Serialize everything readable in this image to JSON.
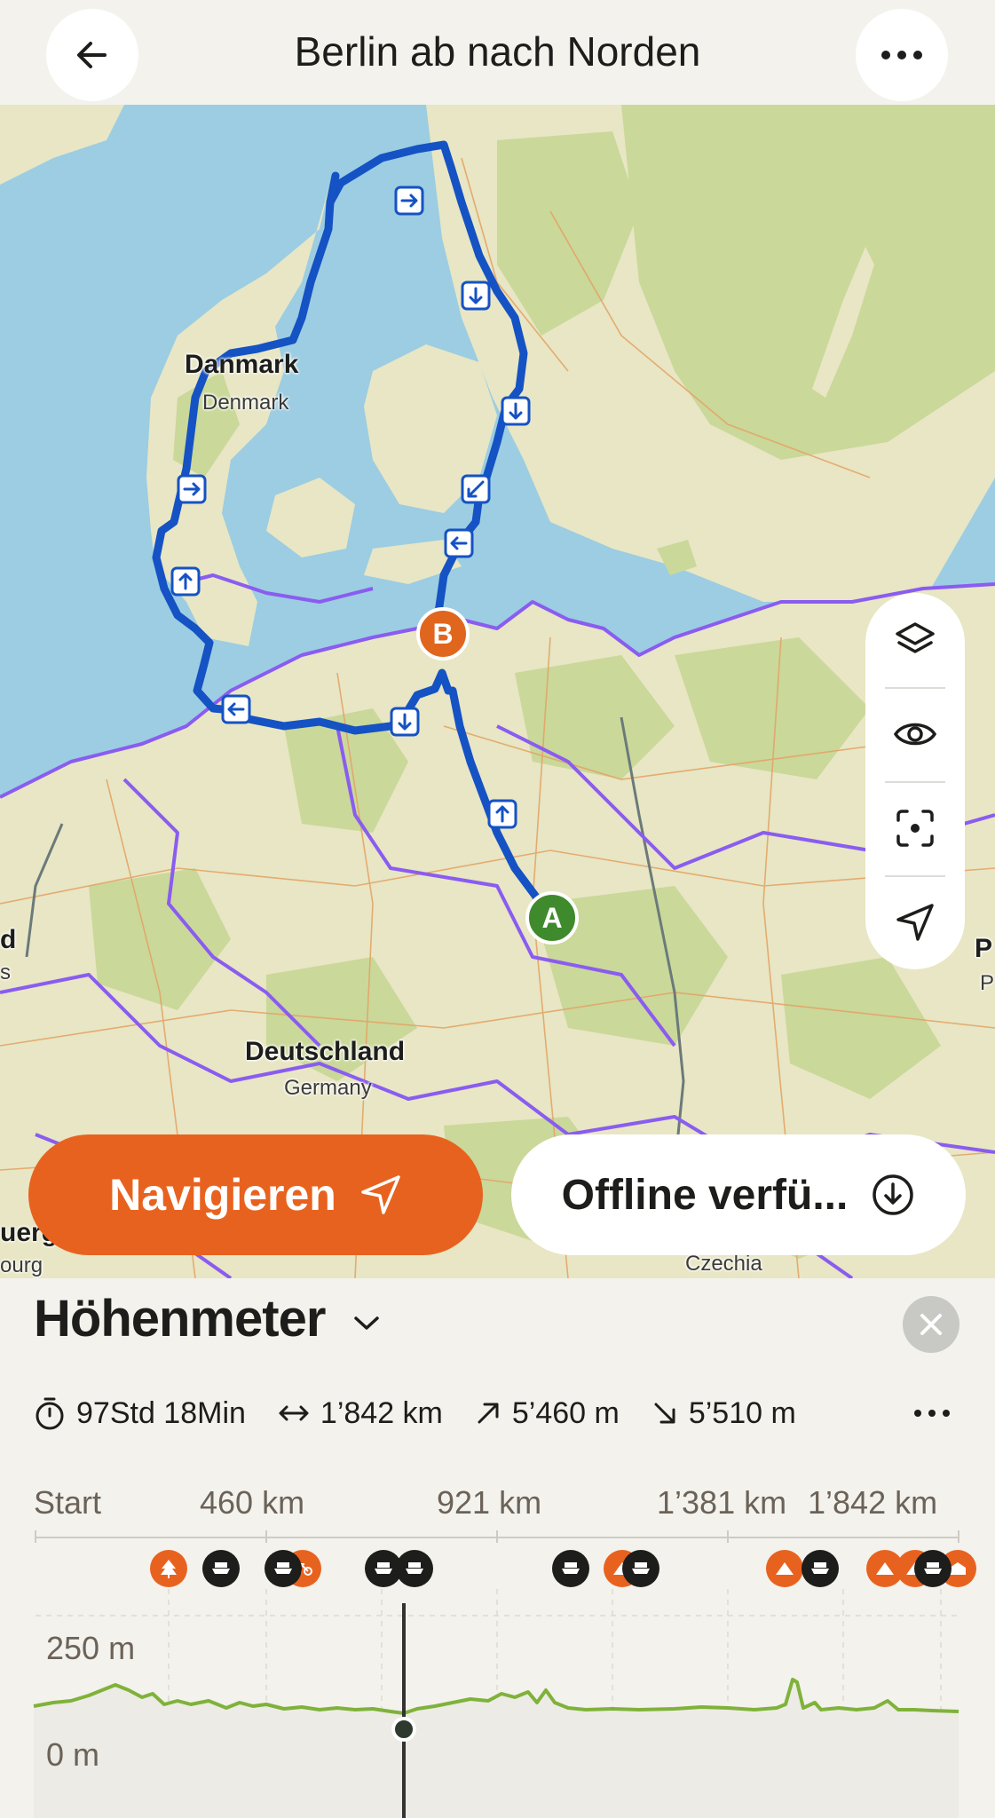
{
  "header": {
    "title": "Berlin ab nach Norden",
    "back_icon": "arrow-left-icon",
    "more_icon": "more-horizontal-icon"
  },
  "map": {
    "labels": {
      "denmark_local": "Danmark",
      "denmark_en": "Denmark",
      "germany_local": "Deutschland",
      "germany_en": "Germany",
      "czechia": "Czechia",
      "edge_left_1": "d",
      "edge_left_2": "s",
      "edge_left_3": "uerg",
      "edge_left_4": "ourg",
      "edge_right_1": "P",
      "edge_right_2": "P"
    },
    "start_marker": "A",
    "end_marker": "B",
    "colors": {
      "water": "#9ccde2",
      "land": "#e8e6c4",
      "forest": "#cad89a",
      "route": "#1552c4",
      "border": "#8a5cf0",
      "start": "#3f8a2c",
      "end": "#e0661d"
    },
    "toolbar": [
      "layers-icon",
      "eye-icon",
      "focus-icon",
      "locate-arrow-icon"
    ]
  },
  "actions": {
    "navigate_label": "Navigieren",
    "offline_label": "Offline verfü...",
    "colors": {
      "navigate_bg": "#e8621f"
    }
  },
  "elevation": {
    "title": "Höhenmeter",
    "stats": {
      "duration": "97Std 18Min",
      "distance": "1’842 km",
      "ascent": "5’460 m",
      "descent": "5’510 m"
    },
    "axis": [
      "Start",
      "460 km",
      "921 km",
      "1’381 km",
      "1’842 km"
    ],
    "elev_labels": [
      "250 m",
      "0 m"
    ],
    "profile_color": "#7fb23a"
  }
}
